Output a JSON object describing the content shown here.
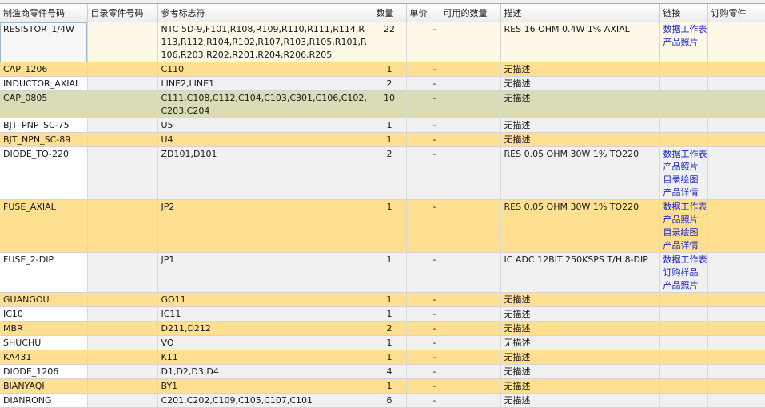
{
  "headers": {
    "mfr_part": "制造商零件号码",
    "catalog_part": "目录零件号码",
    "ref_des": "参考标志符",
    "qty": "数量",
    "unit_price": "单价",
    "available": "可用的数量",
    "description": "描述",
    "links": "链接",
    "order_part": "订购零件"
  },
  "colors": {
    "highlight_row": "#ffdf90",
    "selected_row": "#dbdbb5",
    "link": "#1b27c9",
    "grid_bg": "#f1f1f1"
  },
  "rows": [
    {
      "mfr_part": "RESISTOR_1/4W",
      "catalog_part": "",
      "ref_des": "NTC 5D-9,F101,R108,R109,R110,R111,R114,R113,R112,R104,R102,R107,R103,R105,R101,R106,R203,R202,R201,R204,R206,R205",
      "qty": "22",
      "unit_price": "-",
      "available": "",
      "description": "RES 16 OHM 0.4W 1% AXIAL",
      "links": [
        "数据工作表",
        "产品照片"
      ],
      "order_part": ""
    },
    {
      "mfr_part": "CAP_1206",
      "catalog_part": "",
      "ref_des": "C110",
      "qty": "1",
      "unit_price": "-",
      "available": "",
      "description": "无描述",
      "links": [],
      "order_part": ""
    },
    {
      "mfr_part": "INDUCTOR_AXIAL",
      "catalog_part": "",
      "ref_des": "LINE2,LINE1",
      "qty": "2",
      "unit_price": "-",
      "available": "",
      "description": "无描述",
      "links": [],
      "order_part": ""
    },
    {
      "mfr_part": "CAP_0805",
      "catalog_part": "",
      "ref_des": "C111,C108,C112,C104,C103,C301,C106,C102,C203,C204",
      "qty": "10",
      "unit_price": "-",
      "available": "",
      "description": "无描述",
      "links": [],
      "order_part": ""
    },
    {
      "mfr_part": "BJT_PNP_SC-75",
      "catalog_part": "",
      "ref_des": "U5",
      "qty": "1",
      "unit_price": "-",
      "available": "",
      "description": "无描述",
      "links": [],
      "order_part": ""
    },
    {
      "mfr_part": "BJT_NPN_SC-89",
      "catalog_part": "",
      "ref_des": "U4",
      "qty": "1",
      "unit_price": "-",
      "available": "",
      "description": "无描述",
      "links": [],
      "order_part": ""
    },
    {
      "mfr_part": "DIODE_TO-220",
      "catalog_part": "",
      "ref_des": "ZD101,D101",
      "qty": "2",
      "unit_price": "-",
      "available": "",
      "description": "RES 0.05 OHM 30W 1% TO220",
      "links": [
        "数据工作表",
        "产品照片",
        "目录绘图",
        "产品详情"
      ],
      "order_part": ""
    },
    {
      "mfr_part": "FUSE_AXIAL",
      "catalog_part": "",
      "ref_des": "JP2",
      "qty": "1",
      "unit_price": "-",
      "available": "",
      "description": "RES 0.05 OHM 30W 1% TO220",
      "links": [
        "数据工作表",
        "产品照片",
        "目录绘图",
        "产品详情"
      ],
      "order_part": ""
    },
    {
      "mfr_part": "FUSE_2-DIP",
      "catalog_part": "",
      "ref_des": "JP1",
      "qty": "1",
      "unit_price": "-",
      "available": "",
      "description": "IC ADC 12BIT 250KSPS T/H 8-DIP",
      "links": [
        "数据工作表",
        "订购样品",
        "产品照片"
      ],
      "order_part": ""
    },
    {
      "mfr_part": "GUANGOU",
      "catalog_part": "",
      "ref_des": "GO11",
      "qty": "1",
      "unit_price": "-",
      "available": "",
      "description": "无描述",
      "links": [],
      "order_part": ""
    },
    {
      "mfr_part": "IC10",
      "catalog_part": "",
      "ref_des": "IC11",
      "qty": "1",
      "unit_price": "-",
      "available": "",
      "description": "无描述",
      "links": [],
      "order_part": ""
    },
    {
      "mfr_part": "MBR",
      "catalog_part": "",
      "ref_des": "D211,D212",
      "qty": "2",
      "unit_price": "-",
      "available": "",
      "description": "无描述",
      "links": [],
      "order_part": ""
    },
    {
      "mfr_part": "SHUCHU",
      "catalog_part": "",
      "ref_des": "VO",
      "qty": "1",
      "unit_price": "-",
      "available": "",
      "description": "无描述",
      "links": [],
      "order_part": ""
    },
    {
      "mfr_part": "KA431",
      "catalog_part": "",
      "ref_des": "K11",
      "qty": "1",
      "unit_price": "-",
      "available": "",
      "description": "无描述",
      "links": [],
      "order_part": ""
    },
    {
      "mfr_part": "DIODE_1206",
      "catalog_part": "",
      "ref_des": "D1,D2,D3,D4",
      "qty": "4",
      "unit_price": "-",
      "available": "",
      "description": "无描述",
      "links": [],
      "order_part": ""
    },
    {
      "mfr_part": "BIANYAQI",
      "catalog_part": "",
      "ref_des": "BY1",
      "qty": "1",
      "unit_price": "-",
      "available": "",
      "description": "无描述",
      "links": [],
      "order_part": ""
    },
    {
      "mfr_part": "DIANRONG",
      "catalog_part": "",
      "ref_des": "C201,C202,C109,C105,C107,C101",
      "qty": "6",
      "unit_price": "-",
      "available": "",
      "description": "无描述",
      "links": [],
      "order_part": ""
    }
  ]
}
